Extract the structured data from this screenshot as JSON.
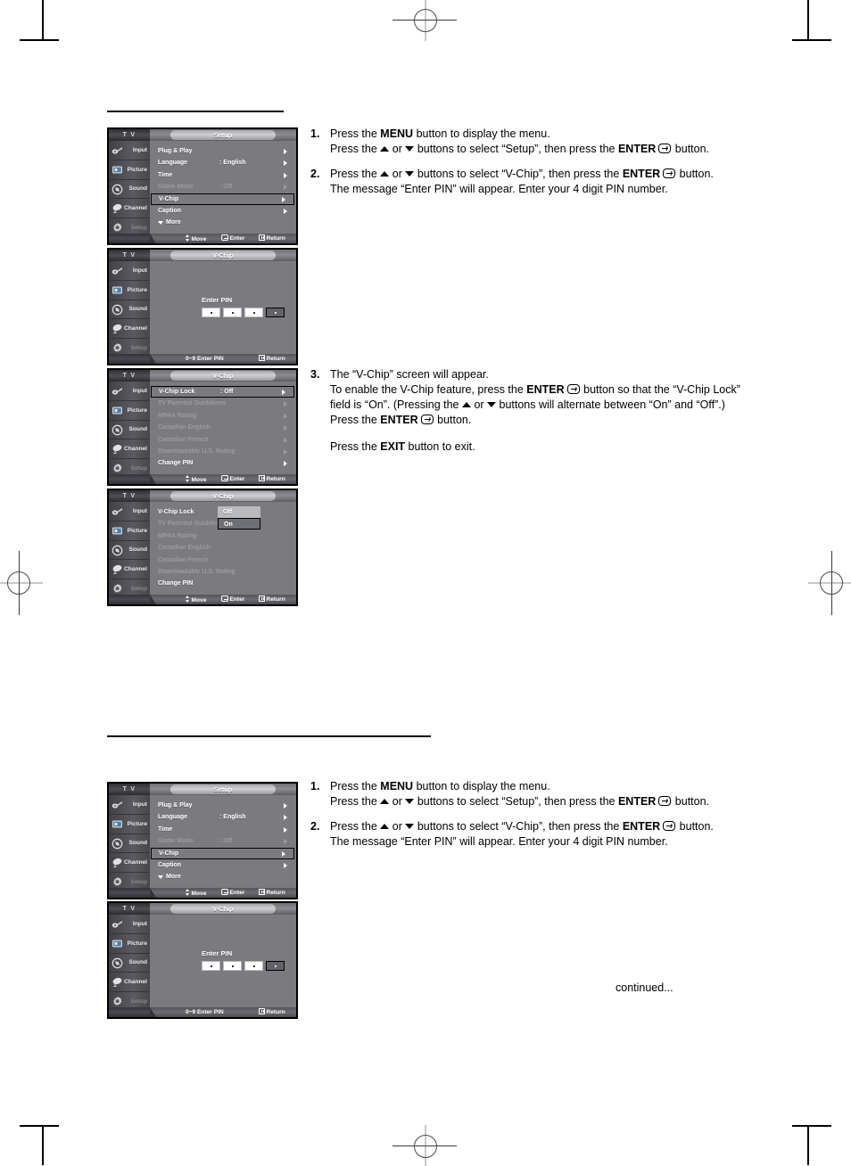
{
  "page": {
    "continued_note": "continued..."
  },
  "osd_common": {
    "tv_label": "T V",
    "sidebar": [
      {
        "label": "Input",
        "icon": "input-jack-icon",
        "dim": false
      },
      {
        "label": "Picture",
        "icon": "picture-icon",
        "dim": false
      },
      {
        "label": "Sound",
        "icon": "sound-icon",
        "dim": false
      },
      {
        "label": "Channel",
        "icon": "satellite-icon",
        "dim": false
      },
      {
        "label": "Setup",
        "icon": "gear-icon",
        "dim": true
      }
    ],
    "footer": {
      "move": "Move",
      "enter": "Enter",
      "return": "Return",
      "pin_hint": "0~9 Enter PIN"
    }
  },
  "menus": {
    "setup": {
      "title": "Setup",
      "rows": [
        {
          "label": "Plug & Play",
          "value": "",
          "chevron": true,
          "dim": false,
          "selected": false
        },
        {
          "label": "Language",
          "value": ": English",
          "chevron": true,
          "dim": false,
          "selected": false
        },
        {
          "label": "Time",
          "value": "",
          "chevron": true,
          "dim": false,
          "selected": false
        },
        {
          "label": "Game Mode",
          "value": ": Off",
          "chevron": true,
          "dim": true,
          "selected": false
        },
        {
          "label": "V-Chip",
          "value": "",
          "chevron": true,
          "dim": false,
          "selected": true
        },
        {
          "label": "Caption",
          "value": "",
          "chevron": true,
          "dim": false,
          "selected": false
        },
        {
          "label": "More",
          "value": "",
          "chevron": false,
          "dim": false,
          "selected": false,
          "more": true
        }
      ]
    },
    "pin": {
      "title": "V-Chip",
      "enter_pin_label": "Enter PIN",
      "digits": [
        "·",
        "·",
        "·",
        "·"
      ],
      "active_index": 3
    },
    "vchip": {
      "title": "V-Chip",
      "rows": [
        {
          "label": "V-Chip Lock",
          "value": ": Off",
          "chevron": true,
          "dim": false,
          "selected": true
        },
        {
          "label": "TV Parental Guidelines",
          "value": "",
          "chevron": true,
          "dim": true,
          "selected": false
        },
        {
          "label": "MPAA Rating",
          "value": "",
          "chevron": true,
          "dim": true,
          "selected": false
        },
        {
          "label": "Canadian English",
          "value": "",
          "chevron": true,
          "dim": true,
          "selected": false
        },
        {
          "label": "Canadian French",
          "value": "",
          "chevron": true,
          "dim": true,
          "selected": false
        },
        {
          "label": "Downloadable U.S. Rating",
          "value": "",
          "chevron": true,
          "dim": true,
          "selected": false
        },
        {
          "label": "Change PIN",
          "value": "",
          "chevron": true,
          "dim": false,
          "selected": false
        }
      ]
    },
    "vchip_dropdown": {
      "title": "V-Chip",
      "rows": [
        {
          "label": "V-Chip Lock",
          "value": ":",
          "chevron": false,
          "dim": false,
          "selected": false
        },
        {
          "label": "TV Parental Guidelines",
          "value": "",
          "chevron": false,
          "dim": true,
          "selected": false
        },
        {
          "label": "MPAA Rating",
          "value": "",
          "chevron": false,
          "dim": true,
          "selected": false
        },
        {
          "label": "Canadian English",
          "value": "",
          "chevron": false,
          "dim": true,
          "selected": false
        },
        {
          "label": "Canadian French",
          "value": "",
          "chevron": false,
          "dim": true,
          "selected": false
        },
        {
          "label": "Downloadable U.S. Rating",
          "value": "",
          "chevron": false,
          "dim": true,
          "selected": false
        },
        {
          "label": "Change PIN",
          "value": "",
          "chevron": false,
          "dim": false,
          "selected": false
        }
      ],
      "option_off": "Off",
      "option_on": "On"
    }
  },
  "instructions_top": {
    "s1_num": "1.",
    "s1_l1_a": "Press the ",
    "s1_l1_b": "MENU",
    "s1_l1_c": " button to display the menu.",
    "s1_l2_a": "Press the ",
    "s1_l2_b": " or ",
    "s1_l2_c": " buttons to select “Setup”, then press the ",
    "s1_l2_d": "ENTER",
    "s1_l2_e": " button.",
    "s2_num": "2.",
    "s2_l1_a": "Press the ",
    "s2_l1_b": " or ",
    "s2_l1_c": " buttons to select “V-Chip”, then press the ",
    "s2_l1_d": "ENTER",
    "s2_l1_e": " button.",
    "s2_l2": "The message “Enter PIN” will appear. Enter your 4 digit PIN number.",
    "s3_num": "3.",
    "s3_l1": "The “V-Chip” screen will appear.",
    "s3_l2_a": "To enable the V-Chip feature, press the ",
    "s3_l2_b": "ENTER",
    "s3_l2_c": " button so that the “V-Chip Lock”",
    "s3_l3_a": "field is “On”. (Pressing the ",
    "s3_l3_b": " or ",
    "s3_l3_c": " buttons will alternate between “On” and “Off”.)",
    "s3_l4_a": "Press the ",
    "s3_l4_b": "ENTER",
    "s3_l4_c": " button.",
    "s3_l5_a": "Press the ",
    "s3_l5_b": "EXIT",
    "s3_l5_c": " button to exit."
  },
  "instructions_bottom": {
    "s1_num": "1.",
    "s1_l1_a": "Press the ",
    "s1_l1_b": "MENU",
    "s1_l1_c": " button to display the menu.",
    "s1_l2_a": "Press the ",
    "s1_l2_b": " or ",
    "s1_l2_c": " buttons to select “Setup”, then press the ",
    "s1_l2_d": "ENTER",
    "s1_l2_e": " button.",
    "s2_num": "2.",
    "s2_l1_a": "Press the ",
    "s2_l1_b": " or ",
    "s2_l1_c": " buttons to select “V-Chip”, then press the ",
    "s2_l1_d": "ENTER",
    "s2_l1_e": " button.",
    "s2_l2": "The message “Enter PIN” will appear. Enter your 4 digit PIN number."
  }
}
